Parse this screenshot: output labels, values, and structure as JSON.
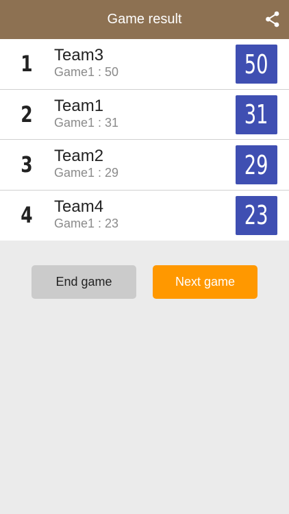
{
  "header": {
    "title": "Game result",
    "share_icon": "share-icon"
  },
  "results": [
    {
      "rank": "1",
      "team": "Team3",
      "detail": "Game1 : 50",
      "score": "50"
    },
    {
      "rank": "2",
      "team": "Team1",
      "detail": "Game1 : 31",
      "score": "31"
    },
    {
      "rank": "3",
      "team": "Team2",
      "detail": "Game1 : 29",
      "score": "29"
    },
    {
      "rank": "4",
      "team": "Team4",
      "detail": "Game1 : 23",
      "score": "23"
    }
  ],
  "actions": {
    "end_label": "End game",
    "next_label": "Next game"
  },
  "colors": {
    "header": "#8d7152",
    "score_badge": "#3f4fb2",
    "next_button": "#ff9800",
    "end_button": "#cbcbcb",
    "background": "#ebebeb"
  }
}
